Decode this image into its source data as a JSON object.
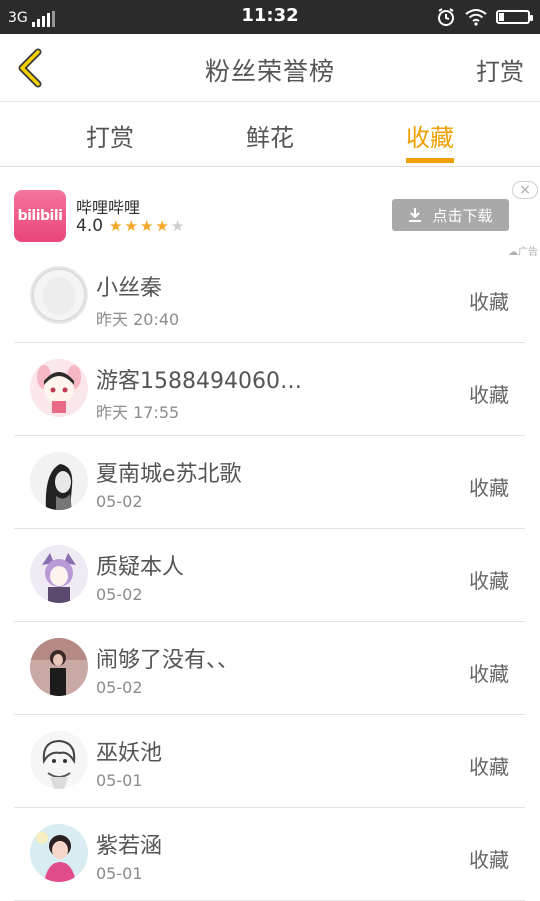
{
  "status_bar": {
    "network": "3G",
    "time": "11:32"
  },
  "header": {
    "title": "粉丝荣誉榜",
    "action": "打赏"
  },
  "tabs": [
    {
      "label": "打赏",
      "active": false
    },
    {
      "label": "鲜花",
      "active": false
    },
    {
      "label": "收藏",
      "active": true
    }
  ],
  "ad": {
    "logo_text": "bilibili",
    "app_name": "哔哩哔哩",
    "rating": "4.0",
    "stars_filled": 4,
    "stars_total": 5,
    "download_label": "点击下载",
    "close_symbol": "×",
    "ad_tag": "广告"
  },
  "fans": [
    {
      "name": "小丝秦",
      "time": "昨天 20:40",
      "action": "收藏"
    },
    {
      "name": "游客1588494060…",
      "time": "昨天 17:55",
      "action": "收藏"
    },
    {
      "name": "夏南城e苏北歌",
      "time": "05-02",
      "action": "收藏"
    },
    {
      "name": "质疑本人",
      "time": "05-02",
      "action": "收藏"
    },
    {
      "name": "闹够了没有、、",
      "time": "05-02",
      "action": "收藏"
    },
    {
      "name": "巫妖池",
      "time": "05-01",
      "action": "收藏"
    },
    {
      "name": "紫若涵",
      "time": "05-01",
      "action": "收藏"
    }
  ],
  "colors": {
    "accent": "#f0a000",
    "text": "#555555",
    "subtext": "#8c8c8c",
    "divider": "#e3e3e3"
  }
}
